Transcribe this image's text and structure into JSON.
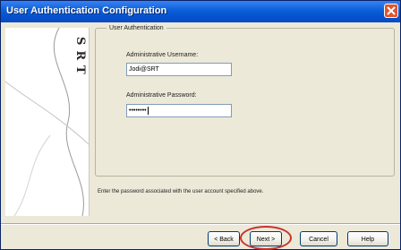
{
  "window": {
    "title": "User Authentication Configuration"
  },
  "sidebar": {
    "logo_text": "SRT"
  },
  "group": {
    "legend": "User Authentication"
  },
  "username": {
    "label": "Administrative Username:",
    "value": "Jodi@SRT"
  },
  "password": {
    "label": "Administrative Password:",
    "value": "••••••••"
  },
  "description": "Enter the password associated with the user account specified above.",
  "buttons": {
    "back": "< Back",
    "next": "Next >",
    "cancel": "Cancel",
    "help": "Help"
  },
  "colors": {
    "title_bar": "#0a5fd8",
    "close_button": "#e0542e",
    "dialog_face": "#ece9d8",
    "next_highlight": "#c9322d"
  }
}
